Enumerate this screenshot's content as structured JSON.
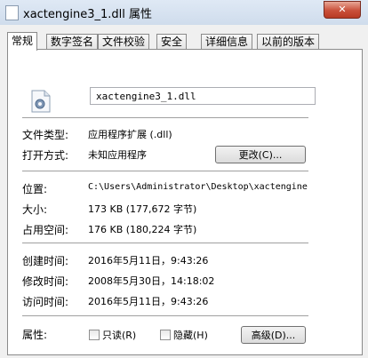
{
  "window": {
    "title": "xactengine3_1.dll 属性",
    "close_glyph": "✕"
  },
  "tabs": [
    {
      "label": "常规"
    },
    {
      "label": "数字签名"
    },
    {
      "label": "文件校验"
    },
    {
      "label": "安全"
    },
    {
      "label": "详细信息"
    },
    {
      "label": "以前的版本"
    }
  ],
  "general": {
    "file_name": "xactengine3_1.dll",
    "file_type": {
      "label": "文件类型:",
      "value": "应用程序扩展 (.dll)"
    },
    "opens_with": {
      "label": "打开方式:",
      "value": "未知应用程序",
      "button": "更改(C)..."
    },
    "location": {
      "label": "位置:",
      "value": "C:\\Users\\Administrator\\Desktop\\xactengine"
    },
    "size": {
      "label": "大小:",
      "value": "173 KB (177,672 字节)"
    },
    "size_on_disk": {
      "label": "占用空间:",
      "value": "176 KB (180,224 字节)"
    },
    "created": {
      "label": "创建时间:",
      "value": "2016年5月11日，9:43:26"
    },
    "modified": {
      "label": "修改时间:",
      "value": "2008年5月30日，14:18:02"
    },
    "accessed": {
      "label": "访问时间:",
      "value": "2016年5月11日，9:43:26"
    },
    "attributes": {
      "label": "属性:",
      "readonly_label": "只读(R)",
      "hidden_label": "隐藏(H)",
      "advanced_button": "高级(D)..."
    }
  },
  "icons": {
    "file": "dll-file-gear-icon"
  }
}
